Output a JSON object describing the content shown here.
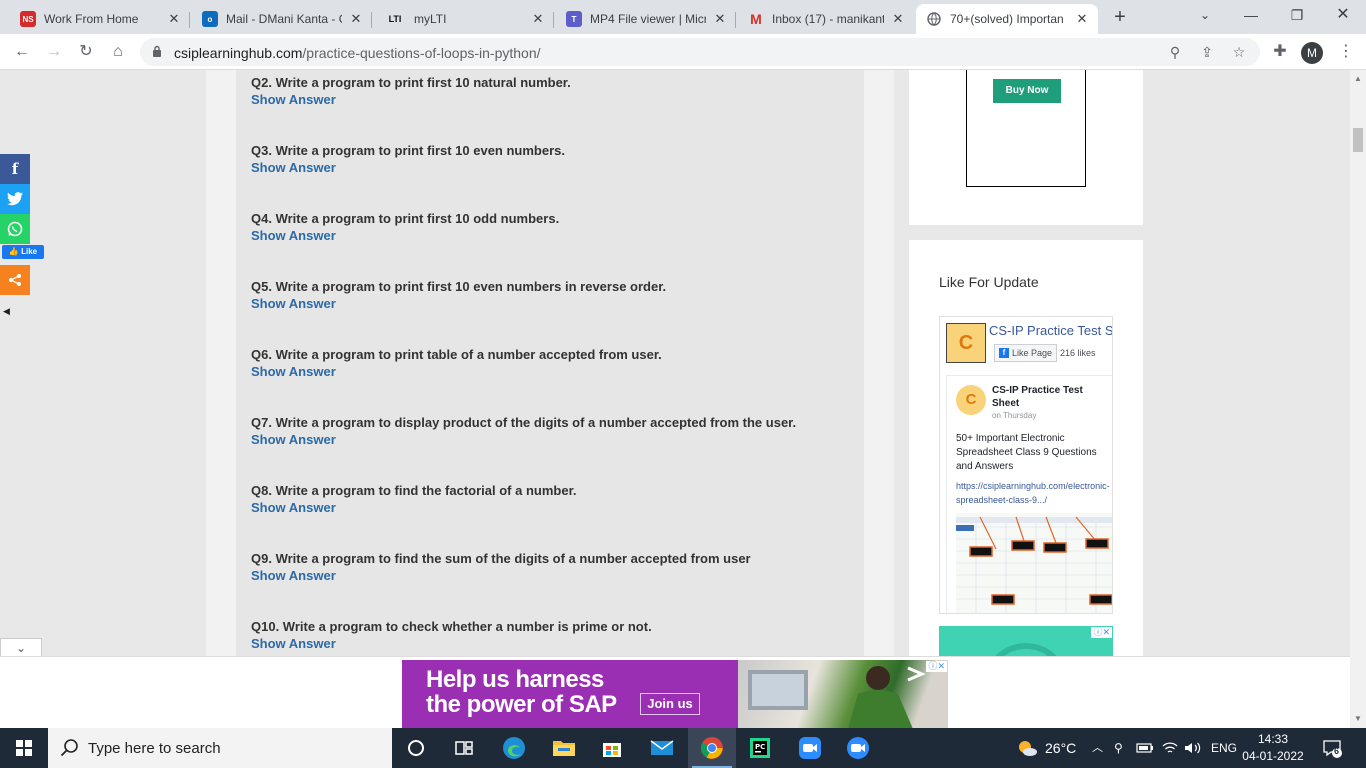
{
  "browser": {
    "tabs": [
      {
        "title": "Work From Home",
        "favicon": "ns-icon"
      },
      {
        "title": "Mail - DMani Kanta - O",
        "favicon": "outlook-icon"
      },
      {
        "title": "myLTI",
        "favicon": "lti-icon"
      },
      {
        "title": "MP4 File viewer | Micr",
        "favicon": "teams-icon"
      },
      {
        "title": "Inbox (17) - manikanta",
        "favicon": "gmail-icon"
      },
      {
        "title": "70+(solved) Importan",
        "favicon": "globe-icon"
      }
    ],
    "url_host": "csiplearninghub.com",
    "url_path": "/practice-questions-of-loops-in-python/",
    "profile_initial": "M"
  },
  "questions": [
    {
      "text": "Q2. Write a program to print first 10 natural number.",
      "answer_label": "Show Answer"
    },
    {
      "text": "Q3. Write a program to print first 10 even numbers.",
      "answer_label": "Show Answer"
    },
    {
      "text": "Q4. Write a program to print first 10 odd numbers.",
      "answer_label": "Show Answer"
    },
    {
      "text": "Q5. Write a program to print first 10 even numbers in reverse order.",
      "answer_label": "Show Answer"
    },
    {
      "text": "Q6. Write a program to print table of a number accepted from user.",
      "answer_label": "Show Answer"
    },
    {
      "text": "Q7. Write a program to display product of the digits of a number accepted from the user.",
      "answer_label": "Show Answer"
    },
    {
      "text": "Q8. Write a program to find the factorial of a number.",
      "answer_label": "Show Answer"
    },
    {
      "text": "Q9. Write a program to find the sum of the digits of a number accepted from user",
      "answer_label": "Show Answer"
    },
    {
      "text": "Q10. Write a program to check whether a number is prime or not.",
      "answer_label": "Show Answer"
    }
  ],
  "sidebar": {
    "buy_now": "Buy Now",
    "like_heading": "Like For Update",
    "fb": {
      "page_name": "CS-IP Practice Test S",
      "avatar_letter": "C",
      "like_page": "Like Page",
      "likes": "216 likes",
      "post_author": "CS-IP Practice Test Sheet",
      "post_date": "on Thursday",
      "post_text": "50+ Important Electronic Spreadsheet Class 9 Questions and Answers",
      "post_link": "https://csiplearninghub.com/electronic-spreadsheet-class-9.../"
    }
  },
  "share_bar": {
    "like_label": "Like"
  },
  "bottom_ad": {
    "line1": "Help us harness",
    "line2": "the power of SAP",
    "cta": "Join us"
  },
  "taskbar": {
    "search_placeholder": "Type here to search",
    "weather": "26°C",
    "language": "ENG",
    "time": "14:33",
    "date": "04-01-2022",
    "notification_count": "6"
  },
  "colors": {
    "accent_link": "#2c6aa8",
    "buy_now": "#1e9e7a",
    "ad_purple": "#9b2fb3"
  }
}
